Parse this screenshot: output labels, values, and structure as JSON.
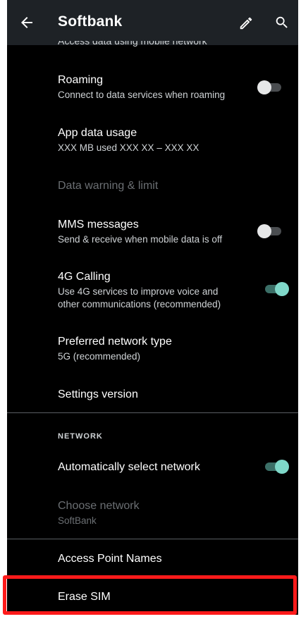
{
  "appbar": {
    "title": "Softbank",
    "back_icon": "arrow-left-icon",
    "edit_icon": "pencil-icon",
    "search_icon": "search-icon"
  },
  "partial_item_text": "Access data using mobile network",
  "items": {
    "roaming": {
      "title": "Roaming",
      "subtitle": "Connect to data services when roaming",
      "toggle": "off"
    },
    "app_data_usage": {
      "title": "App data usage",
      "subtitle": "XXX MB used XXX XX – XXX XX"
    },
    "data_warning": {
      "title": "Data warning & limit"
    },
    "mms": {
      "title": "MMS messages",
      "subtitle": "Send & receive when mobile data is off",
      "toggle": "off"
    },
    "calling_4g": {
      "title": "4G Calling",
      "subtitle_line1": "Use 4G services to improve voice and",
      "subtitle_line2": "other communications (recommended)",
      "toggle": "on"
    },
    "preferred_network": {
      "title": "Preferred network type",
      "subtitle": "5G (recommended)"
    },
    "settings_version": {
      "title": "Settings version"
    }
  },
  "network_section": {
    "header": "NETWORK",
    "auto_select": {
      "title": "Automatically select network",
      "toggle": "on"
    },
    "choose_network": {
      "title": "Choose network",
      "subtitle": "SoftBank"
    }
  },
  "bottom_items": {
    "apn": {
      "title": "Access Point Names"
    },
    "erase_sim": {
      "title": "Erase SIM"
    }
  },
  "colors": {
    "appbar_bg": "#1e2226",
    "screen_bg": "#000000",
    "toggle_on": "#7fd8c9",
    "highlight": "#ff1a1a"
  }
}
